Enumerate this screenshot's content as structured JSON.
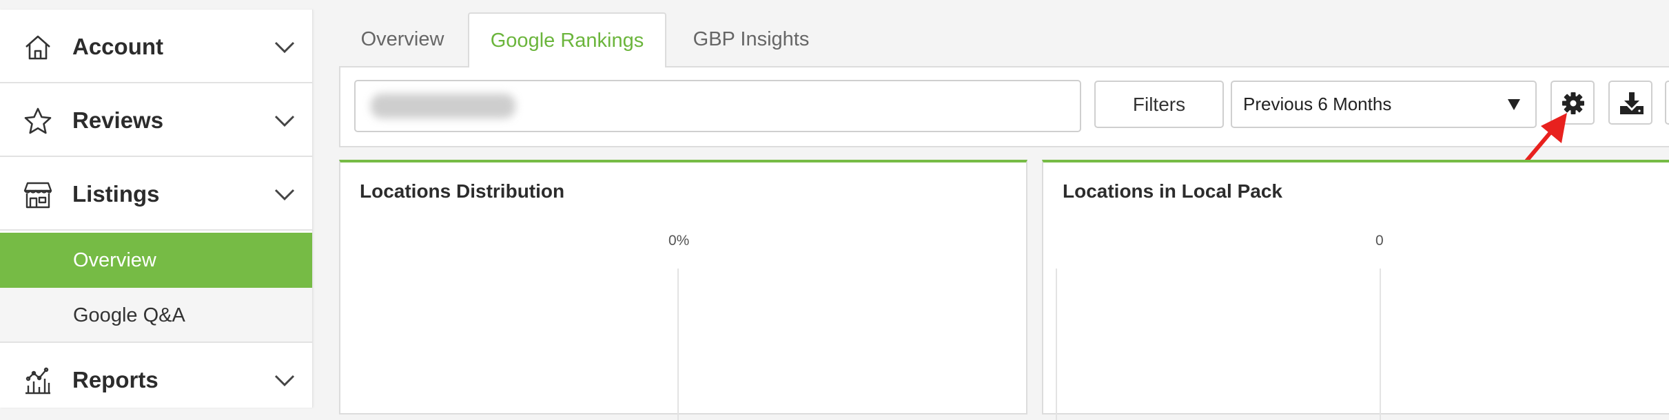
{
  "sidebar": {
    "sections": [
      {
        "label": "Account",
        "icon": "home-icon"
      },
      {
        "label": "Reviews",
        "icon": "star-icon"
      },
      {
        "label": "Listings",
        "icon": "store-icon"
      },
      {
        "label": "Reports",
        "icon": "analytics-icon"
      }
    ],
    "listings_items": [
      {
        "label": "Overview",
        "active": true
      },
      {
        "label": "Google Q&A",
        "active": false
      }
    ]
  },
  "tabs": [
    {
      "label": "Overview",
      "active": false
    },
    {
      "label": "Google Rankings",
      "active": true
    },
    {
      "label": "GBP Insights",
      "active": false
    }
  ],
  "toolbar": {
    "search_value": "",
    "filters_label": "Filters",
    "period_selected": "Previous 6 Months",
    "settings_icon": "gear-icon",
    "download_icon": "download-icon"
  },
  "cards": [
    {
      "title": "Locations Distribution",
      "axis_tick": "0%"
    },
    {
      "title": "Locations in Local Pack",
      "axis_tick": "0"
    }
  ],
  "colors": {
    "accent": "#76bb45",
    "active_tab_text": "#6bb53c",
    "annotation_arrow": "#e8211e"
  }
}
